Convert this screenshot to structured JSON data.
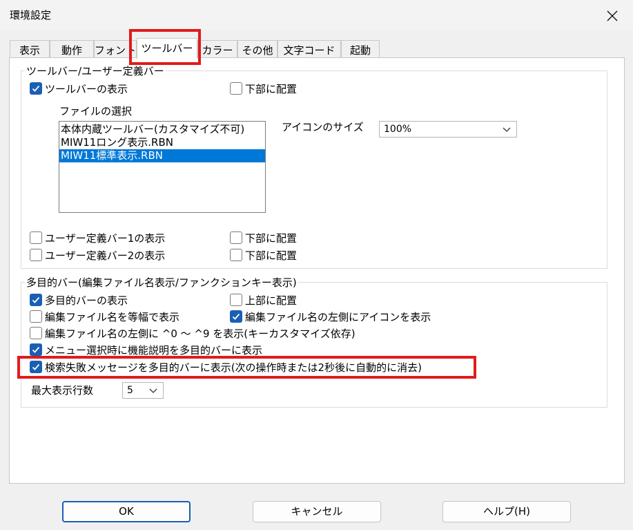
{
  "window": {
    "title": "環境設定"
  },
  "tabs": [
    {
      "label": "表示"
    },
    {
      "label": "動作"
    },
    {
      "label": "フォント"
    },
    {
      "label": "ツールバー"
    },
    {
      "label": "カラー"
    },
    {
      "label": "その他"
    },
    {
      "label": "文字コード"
    },
    {
      "label": "起動"
    }
  ],
  "active_tab": "ツールバー",
  "toolbar_group": {
    "title": "ツールバー/ユーザー定義バー",
    "show_toolbar": {
      "label": "ツールバーの表示",
      "checked": true
    },
    "bottom_toolbar": {
      "label": "下部に配置",
      "checked": false
    },
    "file_select_label": "ファイルの選択",
    "files": [
      {
        "label": "本体内蔵ツールバー(カスタマイズ不可)",
        "selected": false
      },
      {
        "label": "MIW11ロング表示.RBN",
        "selected": false
      },
      {
        "label": "MIW11標準表示.RBN",
        "selected": true
      }
    ],
    "icon_size_label": "アイコンのサイズ",
    "icon_size_value": "100%",
    "user_bar1": {
      "label": "ユーザー定義バー1の表示",
      "checked": false
    },
    "user_bar1_bottom": {
      "label": "下部に配置",
      "checked": false
    },
    "user_bar2": {
      "label": "ユーザー定義バー2の表示",
      "checked": false
    },
    "user_bar2_bottom": {
      "label": "下部に配置",
      "checked": false
    }
  },
  "multibar_group": {
    "title": "多目的バー(編集ファイル名表示/ファンクションキー表示)",
    "show_multibar": {
      "label": "多目的バーの表示",
      "checked": true
    },
    "top_place": {
      "label": "上部に配置",
      "checked": false
    },
    "monospace_name": {
      "label": "編集ファイル名を等幅で表示",
      "checked": false
    },
    "icon_left": {
      "label": "編集ファイル名の左側にアイコンを表示",
      "checked": true
    },
    "ctrl_keys": {
      "label": "編集ファイル名の左側に ^0 ～ ^9 を表示(キーカスタマイズ依存)",
      "checked": false
    },
    "menu_desc": {
      "label": "メニュー選択時に機能説明を多目的バーに表示",
      "checked": true
    },
    "search_fail": {
      "label": "検索失敗メッセージを多目的バーに表示(次の操作時または2秒後に自動的に消去)",
      "checked": true
    },
    "max_rows_label": "最大表示行数",
    "max_rows_value": "5"
  },
  "buttons": {
    "ok": "OK",
    "cancel": "キャンセル",
    "help": "ヘルプ(H)"
  },
  "colors": {
    "accent": "#1a5fb4",
    "selection": "#0078d7",
    "highlight": "#e01b1b"
  }
}
